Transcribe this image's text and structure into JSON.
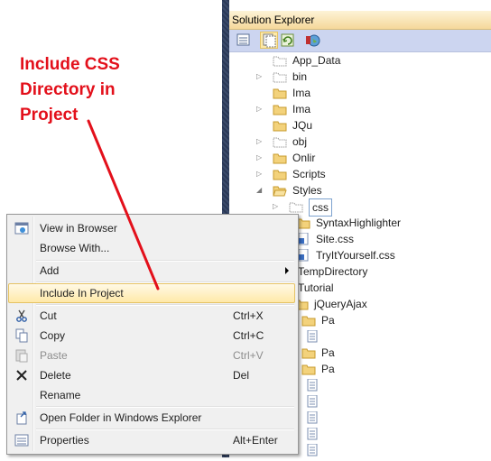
{
  "annotation": {
    "line1": "Include CSS",
    "line2": "Directory in",
    "line3": "Project",
    "color": "#e3101b"
  },
  "solution_explorer": {
    "title": "Solution Explorer",
    "toolbar_icons": [
      "properties-icon",
      "show-all-files-icon",
      "refresh-icon",
      "view-in-browser-icon"
    ],
    "tree": [
      {
        "label": "App_Data",
        "icon": "folder-dashed-icon"
      },
      {
        "label": "bin",
        "icon": "folder-dashed-icon",
        "expander": "▷"
      },
      {
        "label": "Ima",
        "icon": "folder-icon"
      },
      {
        "label": "Ima",
        "icon": "folder-icon",
        "expander": "▷"
      },
      {
        "label": "JQu",
        "icon": "folder-icon"
      },
      {
        "label": "obj",
        "icon": "folder-dashed-icon",
        "expander": "▷"
      },
      {
        "label": "Onlir",
        "icon": "folder-icon",
        "expander": "▷"
      },
      {
        "label": "Scripts",
        "icon": "folder-icon",
        "expander": "▷"
      },
      {
        "label": "Styles",
        "icon": "folder-open-icon",
        "expander": "◢"
      },
      {
        "label": "css",
        "icon": "folder-dashed-icon",
        "expander": "▷"
      },
      {
        "label": "SyntaxHighlighter",
        "icon": "folder-icon"
      },
      {
        "label": "Site.css",
        "icon": "css-file-icon"
      },
      {
        "label": "TryItYourself.css",
        "icon": "css-file-icon"
      },
      {
        "label": "TempDirectory",
        "icon": "folder-icon"
      },
      {
        "label": "Tutorial",
        "icon": "folder-icon"
      },
      {
        "label": "jQueryAjax",
        "icon": "folder-icon"
      },
      {
        "label": "Pa",
        "icon": "folder-icon"
      },
      {
        "label": "",
        "icon": "file-icon"
      },
      {
        "label": "Pa",
        "icon": "folder-icon"
      },
      {
        "label": "Pa",
        "icon": "folder-icon"
      },
      {
        "label": "",
        "icon": "file-icon"
      },
      {
        "label": "",
        "icon": "file-icon"
      },
      {
        "label": "",
        "icon": "file-icon"
      },
      {
        "label": "",
        "icon": "file-icon"
      },
      {
        "label": "",
        "icon": "file-icon"
      }
    ]
  },
  "context_menu": {
    "items": [
      {
        "label": "View in Browser",
        "shortcut": "",
        "icon": "view-in-browser-icon",
        "disabled": false
      },
      {
        "label": "Browse With...",
        "shortcut": "",
        "icon": "",
        "disabled": false
      },
      {
        "label": "Add",
        "shortcut": "",
        "icon": "",
        "disabled": false,
        "submenu": true
      },
      {
        "label": "Include In Project",
        "shortcut": "",
        "icon": "",
        "disabled": false,
        "selected": true
      },
      {
        "label": "Cut",
        "shortcut": "Ctrl+X",
        "icon": "scissors-icon",
        "disabled": false
      },
      {
        "label": "Copy",
        "shortcut": "Ctrl+C",
        "icon": "copy-icon",
        "disabled": false
      },
      {
        "label": "Paste",
        "shortcut": "Ctrl+V",
        "icon": "paste-icon",
        "disabled": true
      },
      {
        "label": "Delete",
        "shortcut": "Del",
        "icon": "delete-icon",
        "disabled": false
      },
      {
        "label": "Rename",
        "shortcut": "",
        "icon": "",
        "disabled": false
      },
      {
        "label": "Open Folder in Windows Explorer",
        "shortcut": "",
        "icon": "open-folder-icon",
        "disabled": false
      },
      {
        "label": "Properties",
        "shortcut": "Alt+Enter",
        "icon": "properties-icon",
        "disabled": false
      }
    ]
  }
}
